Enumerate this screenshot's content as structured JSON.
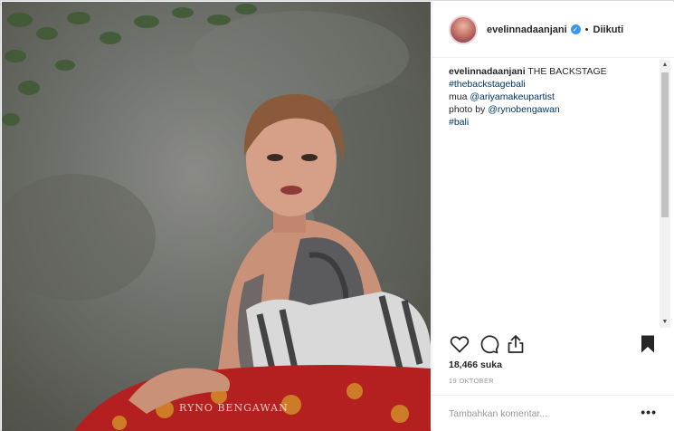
{
  "post": {
    "username": "evelinnadaanjani",
    "verified_icon": "verified-badge-icon",
    "separator": "•",
    "follow_label": "Diikuti",
    "caption": {
      "username": "evelinnadaanjani",
      "text": "THE BACKSTAGE",
      "hashtag1": "#thebackstagebali",
      "mua_prefix": "mua",
      "mua_handle": "@ariyamakeupartist",
      "photo_prefix": "photo by",
      "photo_handle": "@rynobengawan",
      "hashtag2": "#bali"
    },
    "likes": "18,466 suka",
    "date": "19 OKTOBER",
    "comment_placeholder": "Tambahkan komentar...",
    "more_label": "•••",
    "watermark": "RYNO BENGAWAN",
    "icons": [
      "heart-icon",
      "comment-icon",
      "share-icon",
      "bookmark-icon"
    ],
    "colors": {
      "link": "#003569",
      "verified": "#3897f0",
      "muted": "#999999"
    }
  }
}
